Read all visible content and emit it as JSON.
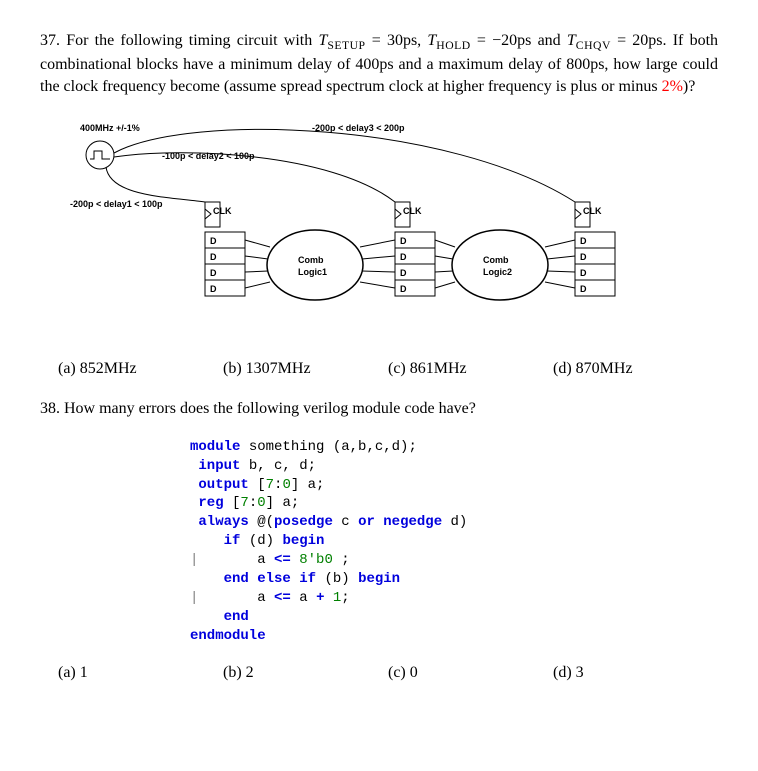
{
  "q37": {
    "number": "37.",
    "line1_a": "For the following timing circuit with ",
    "t_setup_var": "T",
    "t_setup_sub": "SETUP",
    "eq1": " = ",
    "t_setup_val": "30ps,",
    "t_hold_var": "T",
    "t_hold_sub": "HOLD",
    "eq2": " = ",
    "t_hold_val": "−20ps",
    "and_text": " and ",
    "t_chqv_var": "T",
    "t_chqv_sub": "CHQV",
    "eq3": " = ",
    "t_chqv_val": "20ps.",
    "line1_b": " If both combinational blocks have a minimum delay of 400ps and a maximum delay of 800ps, how large could the clock frequency become (assume spread spectrum clock at higher frequency is plus or minus ",
    "pct": "2%",
    "line1_c": ")?",
    "diagram": {
      "clk_freq": "400MHz +/-1%",
      "delay1": "-200p < delay1 < 100p",
      "delay2": "-100p < delay2 < 100p",
      "delay3": "-200p < delay3 < 200p",
      "clk_lbl": "CLK",
      "d_lbl": "D",
      "comb1": "Comb",
      "logic1": "Logic1",
      "comb2": "Comb",
      "logic2": "Logic2"
    },
    "options": {
      "a_lbl": "(a)",
      "a_val": "852MHz",
      "b_lbl": "(b)",
      "b_val": "1307MHz",
      "c_lbl": "(c)",
      "c_val": "861MHz",
      "d_lbl": "(d)",
      "d_val": "870MHz"
    }
  },
  "q38": {
    "number": "38.",
    "text": "How many errors does the following verilog module code have?",
    "code": {
      "l1a": "module",
      "l1b": " something (a,b,c,d);",
      "l2a": " input",
      "l2b": " b, c, d;",
      "l3a": " output",
      "l3b": " [",
      "l3c": "7",
      "l3d": ":",
      "l3e": "0",
      "l3f": "] a;",
      "l4a": " reg",
      "l4b": " [",
      "l4c": "7",
      "l4d": ":",
      "l4e": "0",
      "l4f": "] a;",
      "l5a": " always",
      "l5b": " @(",
      "l5c": "posedge",
      "l5d": " c ",
      "l5e": "or",
      "l5f": " ",
      "l5g": "negedge",
      "l5h": " d)",
      "l6a": "    if",
      "l6b": " (d) ",
      "l6c": "begin",
      "l7a": "       a ",
      "l7b": "<=",
      "l7c": " ",
      "l7d": "8'b0",
      "l7e": " ;",
      "l8a": "    end",
      "l8b": " ",
      "l8c": "else",
      "l8d": " ",
      "l8e": "if",
      "l8f": " (b) ",
      "l8g": "begin",
      "l9a": "       a ",
      "l9b": "<=",
      "l9c": " a ",
      "l9d": "+",
      "l9e": " ",
      "l9f": "1",
      "l9g": ";",
      "l10a": "    end",
      "l11a": "endmodule"
    },
    "options": {
      "a_lbl": "(a)",
      "a_val": "1",
      "b_lbl": "(b)",
      "b_val": "2",
      "c_lbl": "(c)",
      "c_val": "0",
      "d_lbl": "(d)",
      "d_val": "3"
    }
  }
}
